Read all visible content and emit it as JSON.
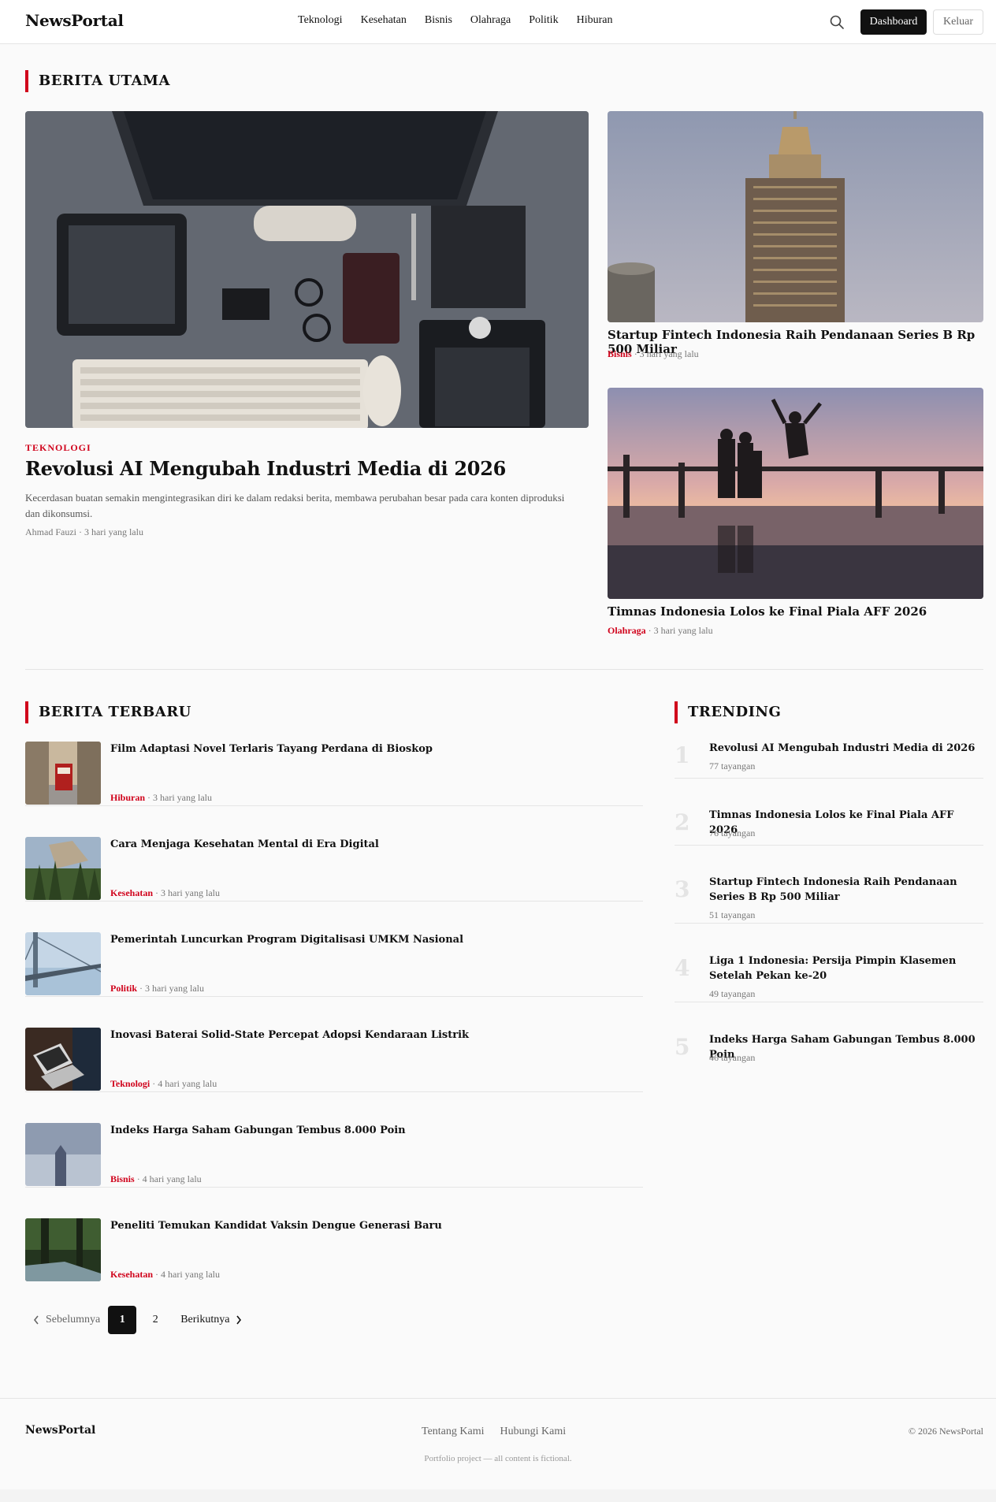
{
  "header": {
    "logo": "NewsPortal",
    "nav": [
      "Teknologi",
      "Kesehatan",
      "Bisnis",
      "Olahraga",
      "Politik",
      "Hiburan"
    ],
    "dashboard_label": "Dashboard",
    "logout_label": "Keluar"
  },
  "featured": {
    "section_title": "BERITA UTAMA",
    "main": {
      "category": "TEKNOLOGI",
      "title": "Revolusi AI Mengubah Industri Media di 2026",
      "excerpt": "Kecerdasan buatan semakin mengintegrasikan diri ke dalam redaksi berita, membawa perubahan besar pada cara konten diproduksi dan dikonsumsi.",
      "meta": "Ahmad Fauzi · 3 hari yang lalu"
    },
    "side": [
      {
        "title": "Startup Fintech Indonesia Raih Pendanaan Series B Rp 500 Miliar",
        "category": "Bisnis",
        "time": " · 3 hari yang lalu"
      },
      {
        "title": "Timnas Indonesia Lolos ke Final Piala AFF 2026",
        "category": "Olahraga",
        "time": " · 3 hari yang lalu"
      }
    ]
  },
  "latest": {
    "section_title": "BERITA TERBARU",
    "items": [
      {
        "title": "Film Adaptasi Novel Terlaris Tayang Perdana di Bioskop",
        "category": "Hiburan",
        "time": " · 3 hari yang lalu"
      },
      {
        "title": "Cara Menjaga Kesehatan Mental di Era Digital",
        "category": "Kesehatan",
        "time": " · 3 hari yang lalu"
      },
      {
        "title": "Pemerintah Luncurkan Program Digitalisasi UMKM Nasional",
        "category": "Politik",
        "time": " · 3 hari yang lalu"
      },
      {
        "title": "Inovasi Baterai Solid-State Percepat Adopsi Kendaraan Listrik",
        "category": "Teknologi",
        "time": " · 4 hari yang lalu"
      },
      {
        "title": "Indeks Harga Saham Gabungan Tembus 8.000 Poin",
        "category": "Bisnis",
        "time": " · 4 hari yang lalu"
      },
      {
        "title": "Peneliti Temukan Kandidat Vaksin Dengue Generasi Baru",
        "category": "Kesehatan",
        "time": " · 4 hari yang lalu"
      }
    ],
    "pagination": {
      "prev": "Sebelumnya",
      "pages": [
        "1",
        "2"
      ],
      "next": "Berikutnya",
      "current": "1"
    }
  },
  "trending": {
    "section_title": "TRENDING",
    "items": [
      {
        "rank": "1",
        "title": "Revolusi AI Mengubah Industri Media di 2026",
        "views": "77 tayangan"
      },
      {
        "rank": "2",
        "title": "Timnas Indonesia Lolos ke Final Piala AFF 2026",
        "views": "76 tayangan"
      },
      {
        "rank": "3",
        "title": "Startup Fintech Indonesia Raih Pendanaan Series B Rp 500 Miliar",
        "views": "51 tayangan"
      },
      {
        "rank": "4",
        "title": "Liga 1 Indonesia: Persija Pimpin Klasemen Setelah Pekan ke-20",
        "views": "49 tayangan"
      },
      {
        "rank": "5",
        "title": "Indeks Harga Saham Gabungan Tembus 8.000 Poin",
        "views": "46 tayangan"
      }
    ]
  },
  "footer": {
    "logo": "NewsPortal",
    "links": [
      "Tentang Kami",
      "Hubungi Kami"
    ],
    "note": "Portfolio project — all content is fictional.",
    "copyright": "© 2026 NewsPortal"
  },
  "colors": {
    "accent": "#d0021b",
    "dark": "#111111"
  }
}
